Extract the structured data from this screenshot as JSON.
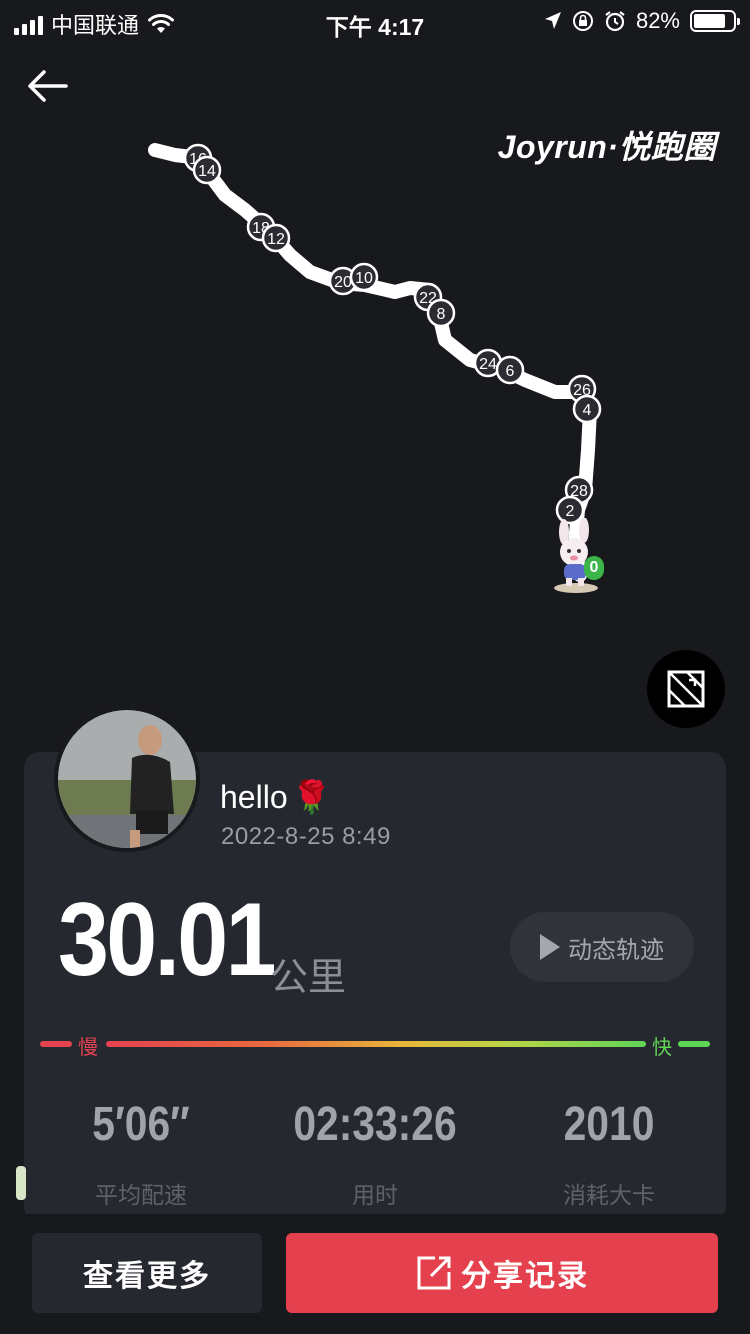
{
  "status_bar": {
    "carrier": "中国联通",
    "time": "下午 4:17",
    "battery": "82%",
    "battery_level": 0.82
  },
  "map": {
    "brand": "Joyrun·悦跑圈",
    "back_icon": "back-arrow-icon",
    "fullscreen_icon": "fullscreen-icon",
    "km_markers": [
      "16",
      "14",
      "18",
      "12",
      "20",
      "10",
      "22",
      "8",
      "24",
      "6",
      "26",
      "4",
      "28",
      "2",
      "0"
    ]
  },
  "user": {
    "name": "hello",
    "emoji": "🌹",
    "date": "2022-8-25 8:49"
  },
  "run": {
    "distance": "30.01",
    "unit": "公里",
    "replay_label": "动态轨迹",
    "speed_slow": "慢",
    "speed_fast": "快",
    "stats": [
      {
        "value": "5′06″",
        "label": "平均配速"
      },
      {
        "value": "02:33:26",
        "label": "用时"
      },
      {
        "value": "2010",
        "label": "消耗大卡"
      }
    ]
  },
  "actions": {
    "more_label": "查看更多",
    "share_label": "分享记录"
  },
  "colors": {
    "background": "#18191d",
    "card": "#262830",
    "accent_red": "#e5404d",
    "accent_green": "#5fd556"
  }
}
